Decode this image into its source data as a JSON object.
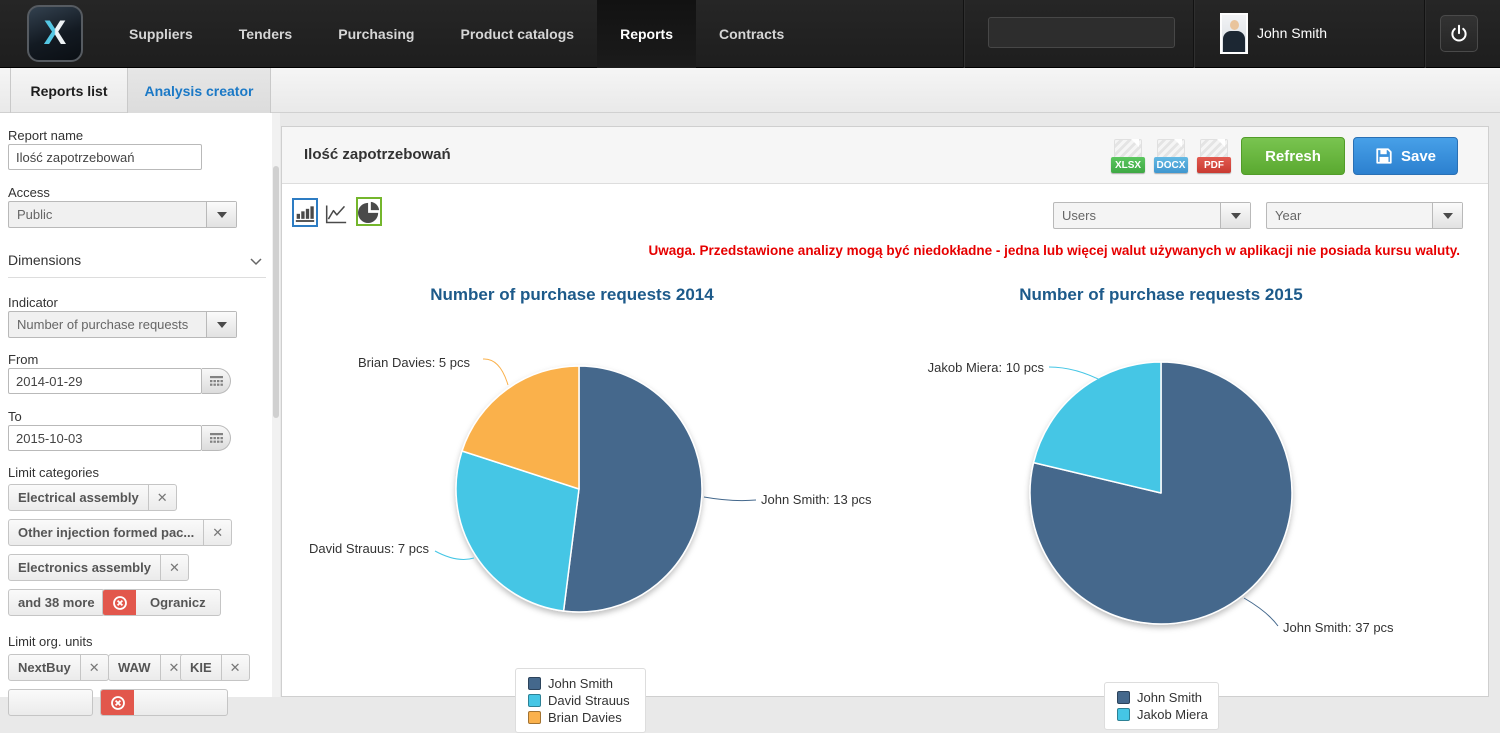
{
  "nav": {
    "logo_letter": "X",
    "items": [
      "Suppliers",
      "Tenders",
      "Purchasing",
      "Product catalogs",
      "Reports",
      "Contracts"
    ],
    "active_item": "Reports",
    "search_value": "",
    "user_name": "John Smith"
  },
  "tabs": {
    "reports_list": "Reports list",
    "analysis_creator": "Analysis creator",
    "active": "Analysis creator"
  },
  "sidebar": {
    "report_name_label": "Report name",
    "report_name_value": "Ilość zapotrzebowań",
    "access_label": "Access",
    "access_value": "Public",
    "dimensions_label": "Dimensions",
    "indicator_label": "Indicator",
    "indicator_value": "Number of purchase requests",
    "from_label": "From",
    "from_value": "2014-01-29",
    "to_label": "To",
    "to_value": "2015-10-03",
    "limit_categories_label": "Limit categories",
    "category_chips": [
      "Electrical assembly",
      "Other injection formed pac...",
      "Electronics assembly"
    ],
    "more_chip": "and 38 more",
    "ogranicz_label": "Ogranicz",
    "limit_org_label": "Limit org. units",
    "org_chips": [
      "NextBuy",
      "WAW",
      "KIE"
    ]
  },
  "main": {
    "title": "Ilość zapotrzebowań",
    "export_badges": [
      "XLSX",
      "DOCX",
      "PDF"
    ],
    "refresh_label": "Refresh",
    "save_label": "Save",
    "group_by_value": "Users",
    "period_value": "Year",
    "warning": "Uwaga. Przedstawione analizy mogą być niedokładne - jedna lub więcej walut używanych w aplikacji nie posiada kursu waluty."
  },
  "chart_data": [
    {
      "type": "pie",
      "title": "Number of purchase requests 2014",
      "unit": "pcs",
      "legend_position": "bottom",
      "series": [
        {
          "name": "John Smith",
          "value": 13,
          "color": "#44688C"
        },
        {
          "name": "David Strauus",
          "value": 7,
          "color": "#45C6E5"
        },
        {
          "name": "Brian Davies",
          "value": 5,
          "color": "#FAB14C"
        }
      ]
    },
    {
      "type": "pie",
      "title": "Number of purchase requests 2015",
      "unit": "pcs",
      "legend_position": "bottom",
      "series": [
        {
          "name": "John Smith",
          "value": 37,
          "color": "#44688C"
        },
        {
          "name": "Jakob Miera",
          "value": 10,
          "color": "#45C6E5"
        }
      ]
    }
  ],
  "colors": {
    "accent_blue": "#2c80cf",
    "accent_green": "#5aa930",
    "warning_red": "#e60000",
    "tab_active_blue": "#1b79c6",
    "chart_title_blue": "#1d5a8a",
    "bar_icon_border": "#2d7cc3",
    "pie_icon_border": "#74b62c"
  }
}
